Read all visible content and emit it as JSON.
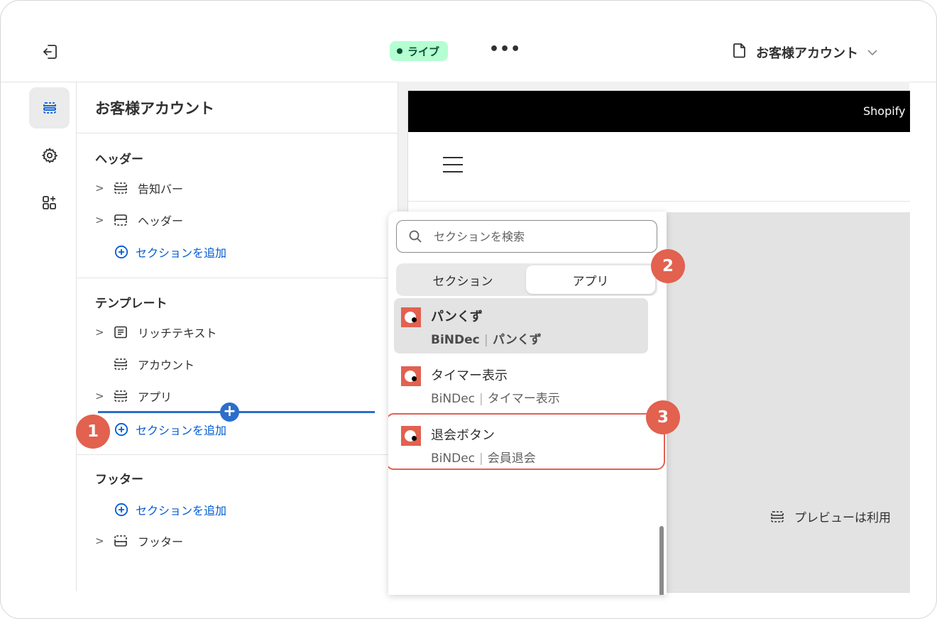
{
  "topbar": {
    "status_badge": "ライブ",
    "more_label": "•••",
    "page_selector": "お客様アカウント"
  },
  "sidebar": {
    "title": "お客様アカウント",
    "groups": [
      {
        "heading": "ヘッダー",
        "items": [
          {
            "label": "告知バー",
            "icon": "announcement-bar-icon",
            "expandable": true
          },
          {
            "label": "ヘッダー",
            "icon": "header-section-icon",
            "expandable": true
          }
        ],
        "add_label": "セクションを追加"
      },
      {
        "heading": "テンプレート",
        "items": [
          {
            "label": "リッチテキスト",
            "icon": "rich-text-icon",
            "expandable": true
          },
          {
            "label": "アカウント",
            "icon": "section-icon",
            "expandable": false
          },
          {
            "label": "アプリ",
            "icon": "section-icon",
            "expandable": true
          }
        ],
        "add_label": "セクションを追加"
      },
      {
        "heading": "フッター",
        "add_label": "セクションを追加",
        "items": [
          {
            "label": "フッター",
            "icon": "footer-section-icon",
            "expandable": true
          }
        ]
      }
    ]
  },
  "preview": {
    "announcement_text": "Shopify",
    "message": "プレビューは利用"
  },
  "popover": {
    "search_placeholder": "セクションを検索",
    "tabs": [
      {
        "label": "セクション",
        "selected": false
      },
      {
        "label": "アプリ",
        "selected": true
      }
    ],
    "apps": [
      {
        "name": "パンくず",
        "vendor": "BiNDec",
        "block": "パンくず"
      },
      {
        "name": "タイマー表示",
        "vendor": "BiNDec",
        "block": "タイマー表示"
      },
      {
        "name": "退会ボタン",
        "vendor": "BiNDec",
        "block": "会員退会"
      }
    ]
  },
  "markers": [
    "1",
    "2",
    "3"
  ],
  "colors": {
    "accent_blue": "#005bd3",
    "insert_line": "#2c6ecb",
    "marker": "#e2614f",
    "live_badge_bg": "#b4fed2"
  }
}
